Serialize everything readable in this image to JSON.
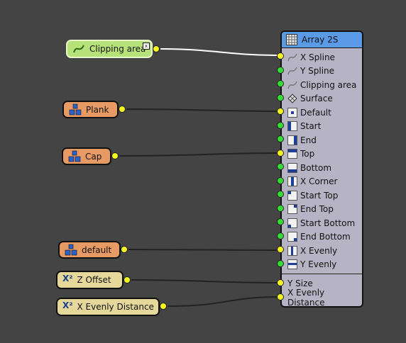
{
  "array_node": {
    "title": "Array 2S",
    "inputs": [
      {
        "label": "X Spline",
        "icon": "spline-icon",
        "port": "yellow"
      },
      {
        "label": "Y Spline",
        "icon": "spline-icon",
        "port": "green"
      },
      {
        "label": "Clipping area",
        "icon": "spline-icon",
        "port": "green"
      },
      {
        "label": "Surface",
        "icon": "surface-icon",
        "port": "green"
      },
      {
        "label": "Default",
        "icon": "tile-center-icon",
        "port": "yellow"
      },
      {
        "label": "Start",
        "icon": "tile-start-icon",
        "port": "green"
      },
      {
        "label": "End",
        "icon": "tile-end-icon",
        "port": "green"
      },
      {
        "label": "Top",
        "icon": "tile-top-icon",
        "port": "yellow"
      },
      {
        "label": "Bottom",
        "icon": "tile-bottom-icon",
        "port": "green"
      },
      {
        "label": "X Corner",
        "icon": "tile-corner-icon",
        "port": "green"
      },
      {
        "label": "Start Top",
        "icon": "tile-start-top-icon",
        "port": "green"
      },
      {
        "label": "End Top",
        "icon": "tile-end-top-icon",
        "port": "green"
      },
      {
        "label": "Start Bottom",
        "icon": "tile-start-bottom-icon",
        "port": "green"
      },
      {
        "label": "End Bottom",
        "icon": "tile-end-bottom-icon",
        "port": "green"
      },
      {
        "label": "X Evenly",
        "icon": "tile-x-evenly-icon",
        "port": "yellow"
      },
      {
        "label": "Y Evenly",
        "icon": "tile-y-evenly-icon",
        "port": "green"
      }
    ],
    "params": [
      {
        "label": "Y Size",
        "port": "yellow"
      },
      {
        "label": "X Evenly Distance",
        "port": "yellow"
      }
    ]
  },
  "source_nodes": {
    "clipping_area": {
      "label": "Clipping area",
      "icon": "spline-icon",
      "close": "x"
    },
    "plank": {
      "label": "Plank",
      "icon": "geometry-blocks-icon"
    },
    "cap": {
      "label": "Cap",
      "icon": "geometry-blocks-icon"
    },
    "default": {
      "label": "default",
      "icon": "geometry-blocks-icon"
    },
    "z_offset": {
      "label": "Z Offset",
      "icon": "x-squared-icon",
      "icon_text": "X²"
    },
    "x_evenly_distance": {
      "label": "X Evenly Distance",
      "icon": "x-squared-icon",
      "icon_text": "X²"
    }
  },
  "colors": {
    "canvas": "#444444",
    "spline_node": "#b7e27a",
    "geometry_node": "#e79a63",
    "number_node": "#e6d79a",
    "array_body": "#b6b4c4",
    "array_header": "#5a9ae6",
    "port_connected": "#f5f520",
    "port_free": "#33dd33",
    "wire": "#222222",
    "wire_selected": "#ffffff"
  }
}
